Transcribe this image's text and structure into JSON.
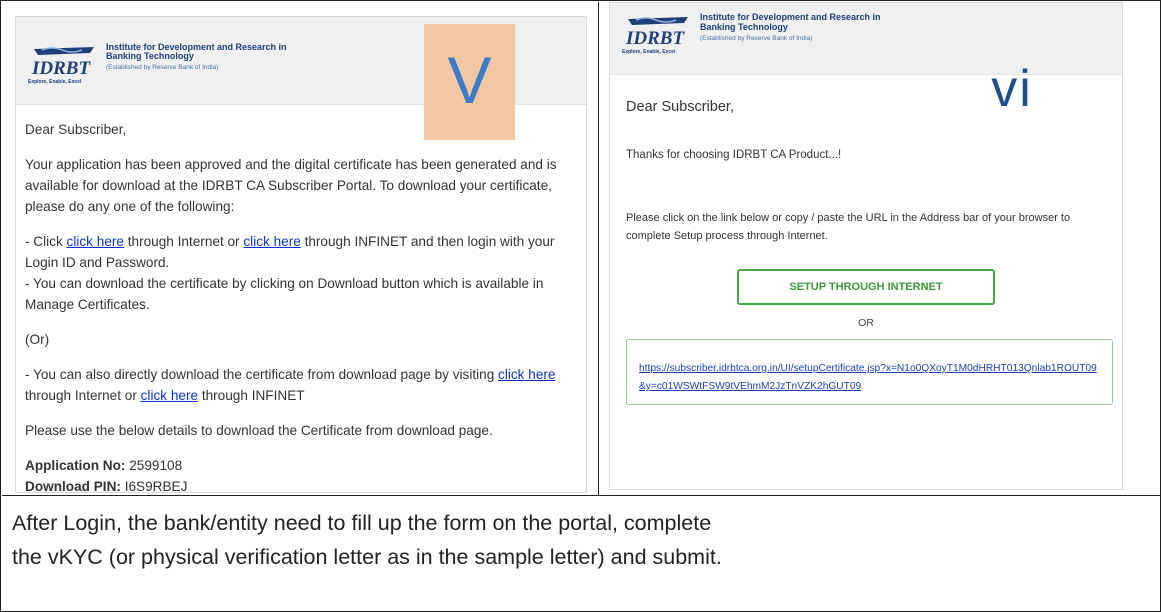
{
  "logo": {
    "mark_text": "IDRBT",
    "org_line1": "Institute for Development and Research in",
    "org_line2": "Banking Technology",
    "established": "(Established by Reserve Bank of India)",
    "tagline": "Explore, Enable, Excel"
  },
  "left_email": {
    "badge": "V",
    "greeting": "Dear Subscriber,",
    "intro": "Your application has been approved and the digital certificate has been generated and is available for download at the IDRBT CA Subscriber Portal. To download your certificate, please do any one of the following:",
    "opt1_prefix": "- Click ",
    "link_click_here": "click here",
    "opt1_mid": " through Internet or ",
    "opt1_suffix": " through INFINET and then login with your Login ID and Password.",
    "opt2": "- You can download the certificate by clicking on Download button which is available in Manage Certificates.",
    "or_text": "(Or)",
    "opt3_prefix": "- You can also directly download the certificate from download page by visiting ",
    "opt3_mid": " through Internet or ",
    "opt3_suffix": " through INFINET",
    "details_note": "Please use the below details to download the Certificate from download page.",
    "app_no_label": "Application No:",
    "app_no_value": " 2599108",
    "pin_label": "Download PIN:",
    "pin_value": " I6S9RBEJ"
  },
  "right_email": {
    "badge": "vi",
    "greeting": "Dear Subscriber,",
    "thanks": "Thanks for choosing IDRBT CA Product...!",
    "instruction": "Please click on the link below or copy / paste the URL in the Address bar of your browser to complete Setup process through Internet.",
    "setup_button": "SETUP THROUGH INTERNET",
    "or_text": "OR",
    "url": "https://subscriber.idrbtca.org.in/UI/setupCertificate.jsp?x=N1o0QXoyT1M0dHRHT013Qnlab1ROUT09&y=c01WSWtFSW9tVEhmM2JzTnVZK2hGUT09"
  },
  "caption": {
    "line1": "After Login, the bank/entity need to fill up the form on the portal, complete",
    "line2": "the vKYC (or physical verification letter as in the sample letter) and submit."
  },
  "colors": {
    "link": "#0b35c8",
    "logo_blue": "#1f3f7a",
    "badge_v_bg": "#f4c7a4",
    "badge_v_fg": "#3b7cc9",
    "setup_green": "#3a9a3a"
  }
}
